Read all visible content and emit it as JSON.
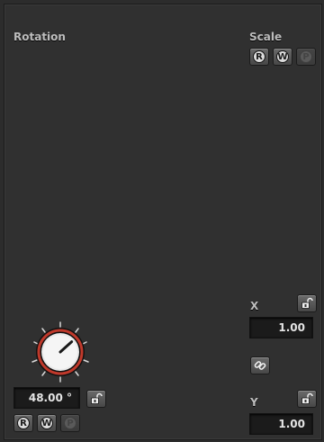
{
  "rotation": {
    "label": "Rotation",
    "value": "48.00 °",
    "dial_angle_deg": 48,
    "buttons": [
      {
        "letter": "R",
        "enabled": true
      },
      {
        "letter": "W",
        "enabled": true
      },
      {
        "letter": "P",
        "enabled": false
      }
    ],
    "lock_icon": "unlocked-padlock-icon",
    "dial_accent": "#c0392b"
  },
  "scale": {
    "label": "Scale",
    "buttons": [
      {
        "letter": "R",
        "enabled": true
      },
      {
        "letter": "W",
        "enabled": true
      },
      {
        "letter": "P",
        "enabled": false
      }
    ],
    "x": {
      "label": "X",
      "value": "1.00",
      "lock_icon": "unlocked-padlock-icon"
    },
    "link_icon": "chain-link-icon",
    "y": {
      "label": "Y",
      "value": "1.00",
      "lock_icon": "unlocked-padlock-icon"
    }
  }
}
